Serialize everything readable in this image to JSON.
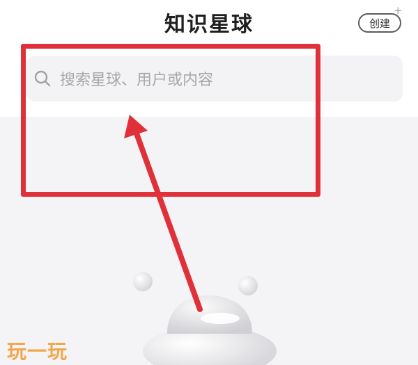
{
  "header": {
    "title": "知识星球",
    "create_label": "创建",
    "create_plus": "+"
  },
  "search": {
    "placeholder": "搜索星球、用户或内容",
    "icon": "search-icon"
  },
  "annotation": {
    "highlight_color": "#e0313b"
  },
  "watermark": {
    "text": "玩一玩"
  }
}
